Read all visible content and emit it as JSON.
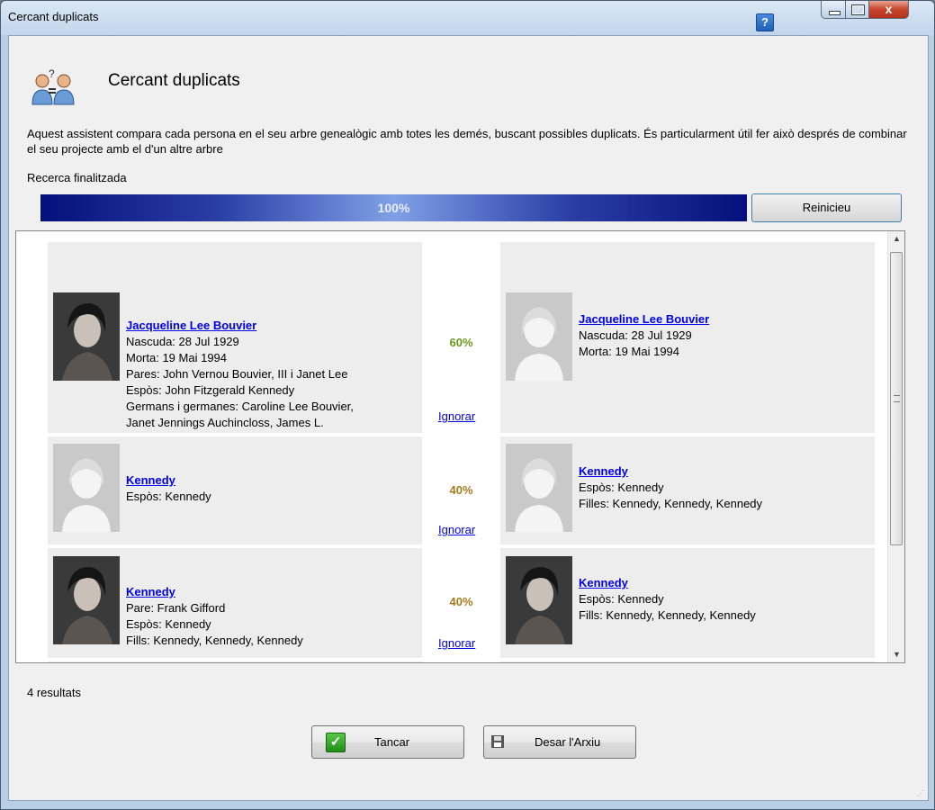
{
  "window": {
    "title": "Cercant duplicats",
    "help_label": "?",
    "close_label": "x"
  },
  "header": {
    "title": "Cercant duplicats"
  },
  "description": "Aquest assistent compara cada persona en el seu arbre genealògic amb totes les demés, buscant possibles duplicats. És particularment útil fer això després de combinar el seu projecte amb el d'un altre arbre",
  "status": "Recerca finalitzada",
  "progress": {
    "label": "100%",
    "value": 1.0
  },
  "restart_label": "Reinicieu",
  "results": [
    {
      "score": "60%",
      "score_color": "#6a9a1a",
      "ignore_label": "Ignorar",
      "left": {
        "name": "Jacqueline Lee Bouvier",
        "photo": "photo",
        "details": [
          "Nascuda: 28 Jul 1929",
          "Morta: 19 Mai 1994",
          "Pares: John Vernou Bouvier, III i Janet Lee",
          "Espòs: John Fitzgerald Kennedy",
          "Germans i germanes: Caroline Lee Bouvier,",
          "Janet Jennings Auchincloss, James L."
        ]
      },
      "right": {
        "name": "Jacqueline Lee Bouvier",
        "photo": "silhouette",
        "details": [
          "Nascuda: 28 Jul 1929",
          "Morta: 19 Mai 1994"
        ]
      }
    },
    {
      "score": "40%",
      "score_color": "#a57a1c",
      "ignore_label": "Ignorar",
      "left": {
        "name": "Kennedy",
        "photo": "silhouette",
        "details": [
          "Espòs: Kennedy"
        ]
      },
      "right": {
        "name": "Kennedy",
        "photo": "silhouette",
        "details": [
          "Espòs: Kennedy",
          "Filles: Kennedy, Kennedy, Kennedy"
        ]
      }
    },
    {
      "score": "40%",
      "score_color": "#a57a1c",
      "ignore_label": "Ignorar",
      "left": {
        "name": "Kennedy",
        "photo": "photo",
        "details": [
          "Pare: Frank Gifford",
          "Espòs: Kennedy",
          "Fills: Kennedy, Kennedy, Kennedy"
        ]
      },
      "right": {
        "name": "Kennedy",
        "photo": "photo",
        "details": [
          "Espòs: Kennedy",
          "Fills: Kennedy, Kennedy, Kennedy"
        ]
      }
    }
  ],
  "count_label": "4 resultats",
  "buttons": {
    "close": "Tancar",
    "save": "Desar l'Arxiu"
  }
}
